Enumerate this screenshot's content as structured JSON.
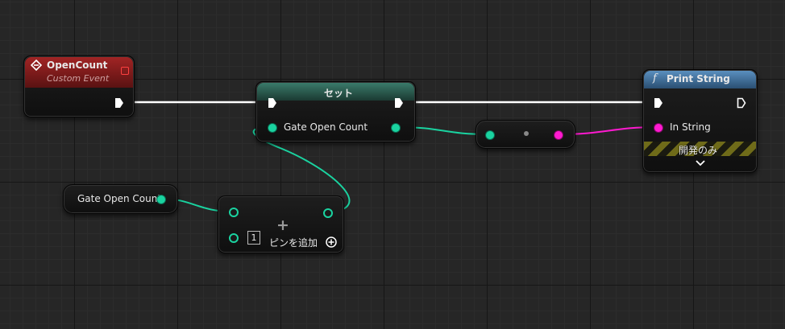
{
  "event_node": {
    "title": "OpenCount",
    "subtitle": "Custom Event"
  },
  "set_node": {
    "title": "セット",
    "pin_label": "Gate Open Count"
  },
  "get_node": {
    "label": "Gate Open Count"
  },
  "add_node": {
    "operator": "+",
    "index": "1",
    "add_pin_label": "ピンを追加"
  },
  "print_node": {
    "title": "Print String",
    "pin_label": "In String",
    "dev_only_label": "開発のみ",
    "function_icon": "f"
  },
  "reroute_node": {
    "name": "conversion-node"
  },
  "colors": {
    "event_header": "#8e1c1c",
    "function_header": "#3f6e93",
    "variable_header": "#2e6a5c",
    "int_pin": "#1ad3a0",
    "string_pin": "#ff1ad0",
    "exec_wire": "#ffffff"
  }
}
